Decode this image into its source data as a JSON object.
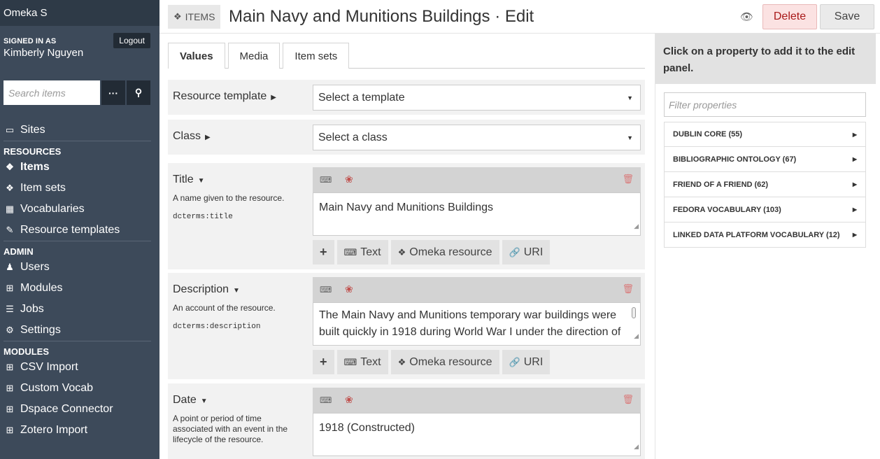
{
  "brand": "Omeka S",
  "signed_in": {
    "label": "SIGNED IN AS",
    "user": "Kimberly Nguyen",
    "logout": "Logout"
  },
  "search": {
    "placeholder": "Search items",
    "more": "···"
  },
  "nav": {
    "sites": "Sites",
    "resources_head": "RESOURCES",
    "items": "Items",
    "item_sets": "Item sets",
    "vocabularies": "Vocabularies",
    "resource_templates": "Resource templates",
    "admin_head": "ADMIN",
    "users": "Users",
    "modules": "Modules",
    "jobs": "Jobs",
    "settings": "Settings",
    "modules_head": "MODULES",
    "csv_import": "CSV Import",
    "custom_vocab": "Custom Vocab",
    "dspace_connector": "Dspace Connector",
    "zotero_import": "Zotero Import"
  },
  "header": {
    "crumb": "ITEMS",
    "title": "Main Navy and Munitions Buildings · Edit",
    "delete": "Delete",
    "save": "Save"
  },
  "tabs": [
    "Values",
    "Media",
    "Item sets"
  ],
  "fields": {
    "resource_template": {
      "label": "Resource template",
      "value": "Select a template"
    },
    "class": {
      "label": "Class",
      "value": "Select a class"
    },
    "title": {
      "label": "Title",
      "desc": "A name given to the resource.",
      "term": "dcterms:title",
      "value": "Main Navy and Munitions Buildings"
    },
    "description": {
      "label": "Description",
      "desc": "An account of the resource.",
      "term": "dcterms:description",
      "value": "The Main Navy and Munitions temporary war buildings were built quickly in 1918 during World War I under the direction of"
    },
    "date": {
      "label": "Date",
      "desc": "A point or period of time associated with an event in the lifecycle of the resource.",
      "value": "1918 (Constructed)"
    }
  },
  "actions": {
    "add": "+",
    "text": "Text",
    "omeka": "Omeka resource",
    "uri": "URI"
  },
  "panel": {
    "heading": "Click on a property to add it to the edit panel.",
    "filter_placeholder": "Filter properties",
    "vocabs": [
      "DUBLIN CORE (55)",
      "BIBLIOGRAPHIC ONTOLOGY (67)",
      "FRIEND OF A FRIEND (62)",
      "FEDORA VOCABULARY (103)",
      "LINKED DATA PLATFORM VOCABULARY (12)"
    ]
  }
}
